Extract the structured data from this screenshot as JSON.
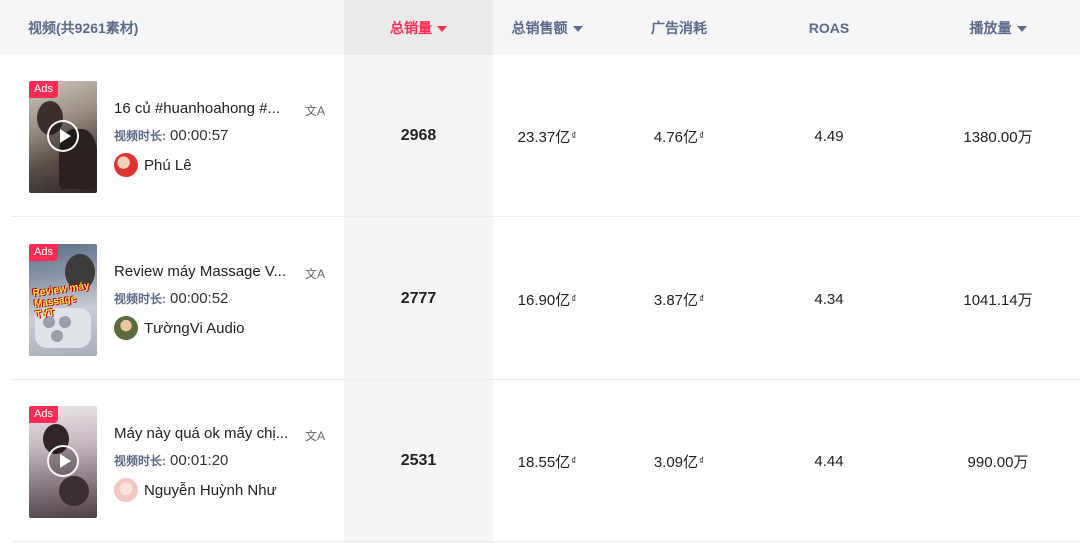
{
  "header": {
    "video_col": "视频(共9261素材)",
    "total_sales": "总销量",
    "total_revenue": "总销售额",
    "ad_spend": "广告消耗",
    "roas": "ROAS",
    "views": "播放量"
  },
  "rows": [
    {
      "ads_badge": "Ads",
      "title": "16 củ #huanhoahong #...",
      "duration_label": "视频时长:",
      "duration": "00:00:57",
      "author": "Phú Lê",
      "total_sales": "2968",
      "revenue": "23.37亿",
      "revenue_currency": "₫",
      "ad_spend": "4.76亿",
      "ad_spend_currency": "₫",
      "roas": "4.49",
      "views": "1380.00万"
    },
    {
      "ads_badge": "Ads",
      "title": "Review máy Massage V...",
      "thumb_text": "Review máy Massage TYT",
      "duration_label": "视频时长:",
      "duration": "00:00:52",
      "author": "TườngVi Audio",
      "total_sales": "2777",
      "revenue": "16.90亿",
      "revenue_currency": "₫",
      "ad_spend": "3.87亿",
      "ad_spend_currency": "₫",
      "roas": "4.34",
      "views": "1041.14万"
    },
    {
      "ads_badge": "Ads",
      "title": "Máy này quá ok mấy chị...",
      "duration_label": "视频时长:",
      "duration": "00:01:20",
      "author": "Nguyễn Huỳnh Như",
      "total_sales": "2531",
      "revenue": "18.55亿",
      "revenue_currency": "₫",
      "ad_spend": "3.09亿",
      "ad_spend_currency": "₫",
      "roas": "4.44",
      "views": "990.00万"
    }
  ],
  "icons": {
    "translate": "文A",
    "play": "play-icon",
    "sort_caret": "caret-down-icon"
  },
  "colors": {
    "accent": "#fe2c55",
    "header_text": "#5c6b8a",
    "header_bg": "#f5f6f8"
  }
}
